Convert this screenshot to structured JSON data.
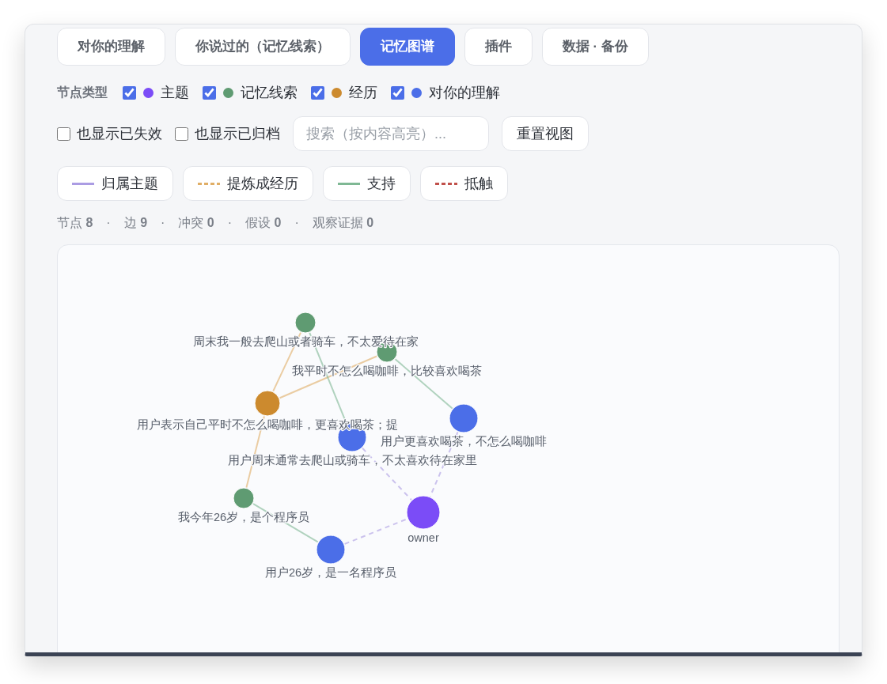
{
  "tabs": [
    {
      "label": "对你的理解",
      "selected": false
    },
    {
      "label": "你说过的（记忆线索）",
      "selected": false
    },
    {
      "label": "记忆图谱",
      "selected": true
    },
    {
      "label": "插件",
      "selected": false
    },
    {
      "label": "数据 · 备份",
      "selected": false
    }
  ],
  "node_filter": {
    "label": "节点类型",
    "types": [
      {
        "kind": "topic",
        "label": "主题",
        "color": "#7b4cf7",
        "checked": true
      },
      {
        "kind": "clue",
        "label": "记忆线索",
        "color": "#5f9b72",
        "checked": true
      },
      {
        "kind": "experience",
        "label": "经历",
        "color": "#cc8a2e",
        "checked": true
      },
      {
        "kind": "understanding",
        "label": "对你的理解",
        "color": "#4b6ee8",
        "checked": true
      }
    ]
  },
  "options": [
    {
      "label": "也显示已失效",
      "checked": false
    },
    {
      "label": "也显示已归档",
      "checked": false
    }
  ],
  "search": {
    "placeholder": "搜索（按内容高亮）..."
  },
  "reset_button": {
    "label": "重置视图"
  },
  "edge_legend": [
    {
      "kind": "belongs",
      "label": "归属主题",
      "color": "#ab9ce3"
    },
    {
      "kind": "refine",
      "label": "提炼成经历",
      "color": "#e0ae66"
    },
    {
      "kind": "support",
      "label": "支持",
      "color": "#7fb894"
    },
    {
      "kind": "conflict",
      "label": "抵触",
      "color": "#c0504a"
    }
  ],
  "stats": [
    {
      "text": "节点 **8**"
    },
    {
      "separator": "·",
      "text": "边 **9**"
    },
    {
      "separator": "·",
      "text": "冲突 **0**"
    },
    {
      "separator": "·",
      "text": "假设 **0**"
    },
    {
      "separator": "·",
      "text": "观察证据 **0**"
    }
  ],
  "graph": {
    "nodes": [
      {
        "kind": "clue",
        "label": "周末我一般去爬山或者骑车，不太爱待在家"
      },
      {
        "kind": "clue",
        "label": "我平时不怎么喝咖啡，比较喜欢喝茶"
      },
      {
        "kind": "experience",
        "label": "用户表示自己平时不怎么喝咖啡，更喜欢喝茶；提"
      },
      {
        "kind": "understanding",
        "label": "用户更喜欢喝茶，不怎么喝咖啡"
      },
      {
        "kind": "understanding",
        "label": "用户周末通常去爬山或骑车，不太喜欢待在家里"
      },
      {
        "kind": "clue",
        "label": "我今年26岁，是个程序员"
      },
      {
        "kind": "topic",
        "label": "owner"
      },
      {
        "kind": "understanding",
        "label": "用户26岁，是一名程序员"
      }
    ],
    "edges": [
      {
        "kind": "refine"
      },
      {
        "kind": "refine"
      },
      {
        "kind": "refine"
      },
      {
        "kind": "support"
      },
      {
        "kind": "support"
      },
      {
        "kind": "support"
      },
      {
        "kind": "belongs"
      },
      {
        "kind": "belongs"
      },
      {
        "kind": "belongs"
      }
    ]
  }
}
